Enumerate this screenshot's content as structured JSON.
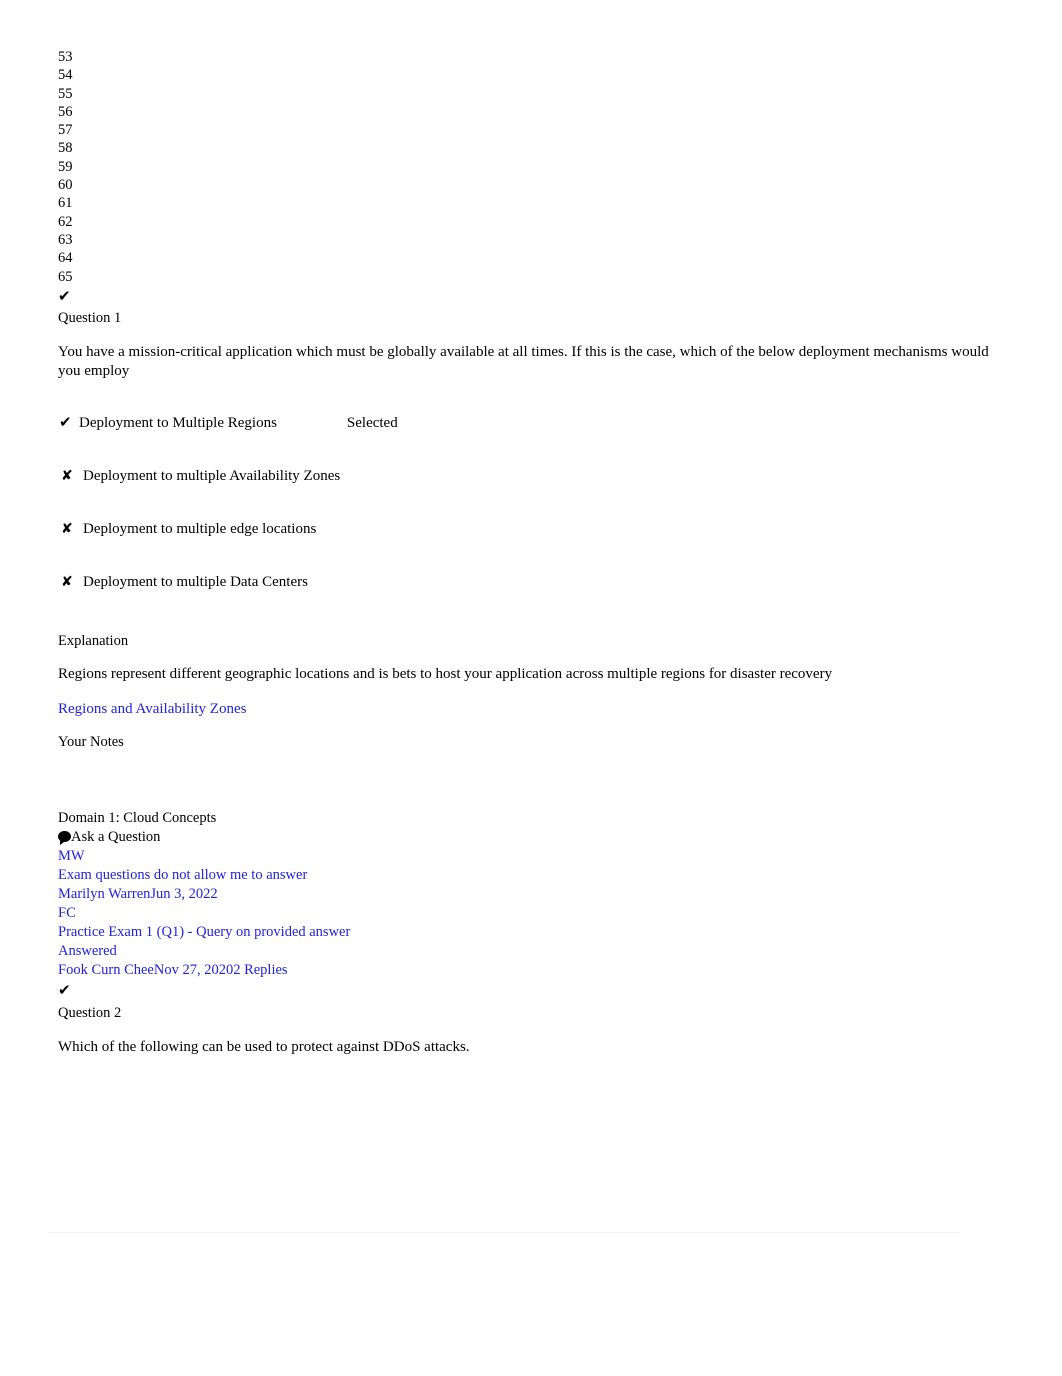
{
  "nav": {
    "numbers": [
      "53",
      "54",
      "55",
      "56",
      "57",
      "58",
      "59",
      "60",
      "61",
      "62",
      "63",
      "64",
      "65"
    ]
  },
  "icons": {
    "check": "✔",
    "cross": "✘",
    "comment": "comment-bubble-icon"
  },
  "question1": {
    "marker": "✔",
    "label": "Question 1",
    "text": "You have a mission-critical application which must be globally available at all times. If this is the case, which of the below deployment mechanisms would you employ",
    "options": [
      {
        "icon": "✔",
        "label": "Deployment to Multiple Regions",
        "state": "Selected",
        "correct": true
      },
      {
        "icon": "✘",
        "label": "Deployment to multiple Availability Zones",
        "state": "",
        "correct": false
      },
      {
        "icon": "✘",
        "label": "Deployment to multiple edge locations",
        "state": "",
        "correct": false
      },
      {
        "icon": "✘",
        "label": "Deployment to multiple Data Centers",
        "state": "",
        "correct": false
      }
    ],
    "explanation_heading": "Explanation",
    "explanation_body": "Regions represent different geographic locations and is bets to host your application across multiple regions for disaster recovery",
    "explanation_link": "Regions and Availability Zones",
    "notes_heading": "Your Notes"
  },
  "discussion": {
    "domain": "Domain 1: Cloud Concepts",
    "ask_label": "Ask a Question",
    "threads": [
      {
        "avatar": "MW",
        "title": "Exam questions do not allow me to answer",
        "meta": "Marilyn WarrenJun 3, 2022",
        "status": ""
      },
      {
        "avatar": "FC",
        "title": "Practice Exam 1 (Q1) - Query on provided answer",
        "meta": "Fook Curn CheeNov 27, 20202 Replies",
        "status": "Answered"
      }
    ]
  },
  "question2": {
    "marker": "✔",
    "label": "Question 2",
    "text": "Which of the following can be used to protect against DDoS attacks."
  },
  "colors": {
    "link": "#2222dd",
    "text": "#000000",
    "background": "#ffffff",
    "divider": "#f4f4f6"
  }
}
